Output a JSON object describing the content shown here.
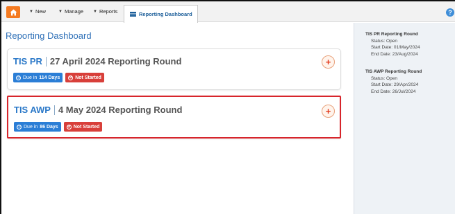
{
  "nav": {
    "items": [
      {
        "label": "New"
      },
      {
        "label": "Manage"
      },
      {
        "label": "Reports"
      }
    ],
    "active_tab": "Reporting Dashboard"
  },
  "main": {
    "page_title": "Reporting Dashboard",
    "cards": [
      {
        "code": "TIS PR",
        "title": "27 April 2024 Reporting Round",
        "due_prefix": "Due in",
        "due_value": "114 Days",
        "status": "Not Started"
      },
      {
        "code": "TIS AWP",
        "title": "4 May 2024 Reporting Round",
        "due_prefix": "Due in",
        "due_value": "86 Days",
        "status": "Not Started"
      }
    ]
  },
  "sidebar": {
    "rounds": [
      {
        "title": "TIS PR Reporting Round",
        "status": "Status: Open",
        "start": "Start Date: 01/May/2024",
        "end": "End Date: 23/Aug/2024"
      },
      {
        "title": "TIS AWP Reporting Round",
        "status": "Status: Open",
        "start": "Start Date: 29/Apr/2024",
        "end": "End Date: 26/Jul/2024"
      }
    ]
  },
  "colors": {
    "accent": "#2b7ed6",
    "home": "#f47a20",
    "danger": "#d83f3a",
    "highlight": "#d7252b"
  }
}
